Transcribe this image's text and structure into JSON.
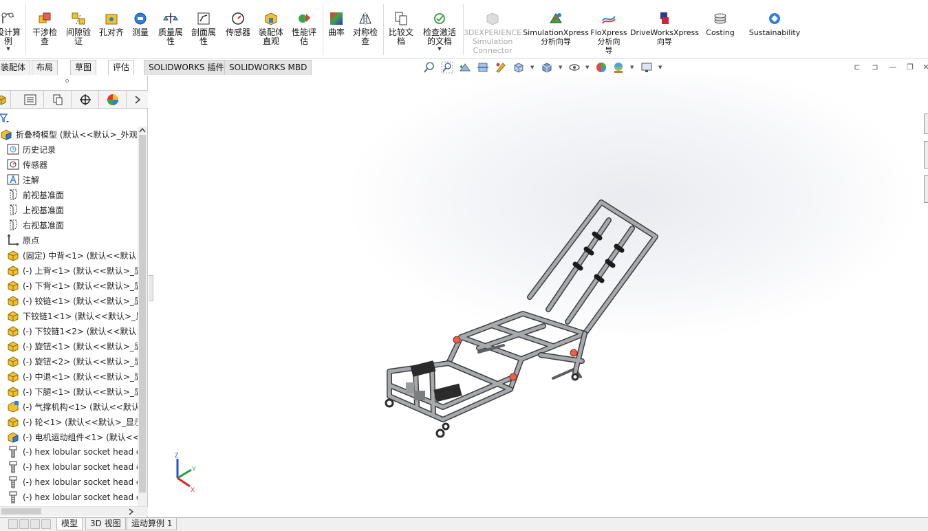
{
  "ribbon": {
    "buttons": [
      {
        "label": "设计算\n例",
        "icon": "design-study-icon"
      },
      {
        "label": "干涉检\n查",
        "icon": "interference-check-icon"
      },
      {
        "label": "间隙验\n证",
        "icon": "clearance-verify-icon"
      },
      {
        "label": "孔对齐",
        "icon": "hole-align-icon"
      },
      {
        "label": "测量",
        "icon": "measure-icon"
      },
      {
        "label": "质量属\n性",
        "icon": "mass-properties-icon"
      },
      {
        "label": "剖面属\n性",
        "icon": "section-properties-icon"
      },
      {
        "label": "传感器",
        "icon": "sensor-icon"
      },
      {
        "label": "装配体\n直观",
        "icon": "assembly-visualization-icon"
      },
      {
        "label": "性能评\n估",
        "icon": "performance-eval-icon"
      },
      {
        "label": "曲率",
        "icon": "curvature-icon"
      },
      {
        "label": "对称检\n查",
        "icon": "symmetry-check-icon"
      },
      {
        "label": "比较文\n档",
        "icon": "compare-docs-icon"
      },
      {
        "label": "检查激活\n的文档",
        "icon": "check-active-doc-icon"
      },
      {
        "label": "3DEXPERIENCE\nSimulation\nConnector",
        "icon": "3dexperience-icon"
      },
      {
        "label": "SimulationXpress\n分析向导",
        "icon": "simulationxpress-icon"
      },
      {
        "label": "FloXpress\n分析向\n导",
        "icon": "floxpress-icon"
      },
      {
        "label": "DriveWorksXpress\n向导",
        "icon": "driveworksxpress-icon"
      },
      {
        "label": "Costing",
        "icon": "costing-icon"
      },
      {
        "label": "Sustainability",
        "icon": "sustainability-icon"
      }
    ]
  },
  "command_tabs": [
    "装配体",
    "布局",
    "草图",
    "评估",
    "SOLIDWORKS 插件",
    "SOLIDWORKS MBD"
  ],
  "tree": {
    "root": "折叠椅模型  (默认<<默认>_外观 显",
    "items": [
      {
        "label": "历史记录",
        "icon": "history-icon"
      },
      {
        "label": "传感器",
        "icon": "sensor-icon"
      },
      {
        "label": "注解",
        "icon": "annotation-icon"
      },
      {
        "label": "前视基准面",
        "icon": "plane-icon"
      },
      {
        "label": "上视基准面",
        "icon": "plane-icon"
      },
      {
        "label": "右视基准面",
        "icon": "plane-icon"
      },
      {
        "label": "原点",
        "icon": "origin-icon"
      },
      {
        "label": "(固定) 中背<1> (默认<<默认>",
        "icon": "part-icon"
      },
      {
        "label": "(-) 上背<1> (默认<<默认>_显",
        "icon": "part-icon"
      },
      {
        "label": "(-) 下背<1> (默认<<默认>_显",
        "icon": "part-icon"
      },
      {
        "label": "(-) 铰链<1> (默认<<默认>_显",
        "icon": "part-icon"
      },
      {
        "label": "下铰链1<1> (默认<<默认>_显",
        "icon": "part-icon"
      },
      {
        "label": "(-) 下铰链1<2> (默认<<默认>",
        "icon": "part-icon"
      },
      {
        "label": "(-) 旋钮<1> (默认<<默认>_显",
        "icon": "part-icon"
      },
      {
        "label": "(-) 旋钮<2> (默认<<默认>_显",
        "icon": "part-icon"
      },
      {
        "label": "(-) 中退<1> (默认<<默认>_显",
        "icon": "part-icon"
      },
      {
        "label": "(-) 下腿<1> (默认<<默认>_显",
        "icon": "part-icon"
      },
      {
        "label": "(-) 气撑机构<1> (默认<<默认",
        "icon": "subassembly-icon"
      },
      {
        "label": "(-) 轮<1> (默认<<默认>_显示",
        "icon": "part-icon"
      },
      {
        "label": "(-) 电机运动组件<1> (默认<<",
        "icon": "assembly-icon"
      },
      {
        "label": "(-) hex lobular socket head c",
        "icon": "screw-icon"
      },
      {
        "label": "(-) hex lobular socket head c",
        "icon": "screw-icon"
      },
      {
        "label": "(-) hex lobular socket head c",
        "icon": "screw-icon"
      },
      {
        "label": "(-) hex lobular socket head c",
        "icon": "screw-icon"
      }
    ]
  },
  "triad": {
    "x": "X",
    "y": "Y",
    "z": "Z"
  },
  "bottom_tabs": [
    "模型",
    "3D 视图",
    "运动算例 1"
  ],
  "colors": {
    "accent_blue": "#1f6fd1",
    "frame_gray": "#8a8c90",
    "knob_red": "#e8604f"
  }
}
